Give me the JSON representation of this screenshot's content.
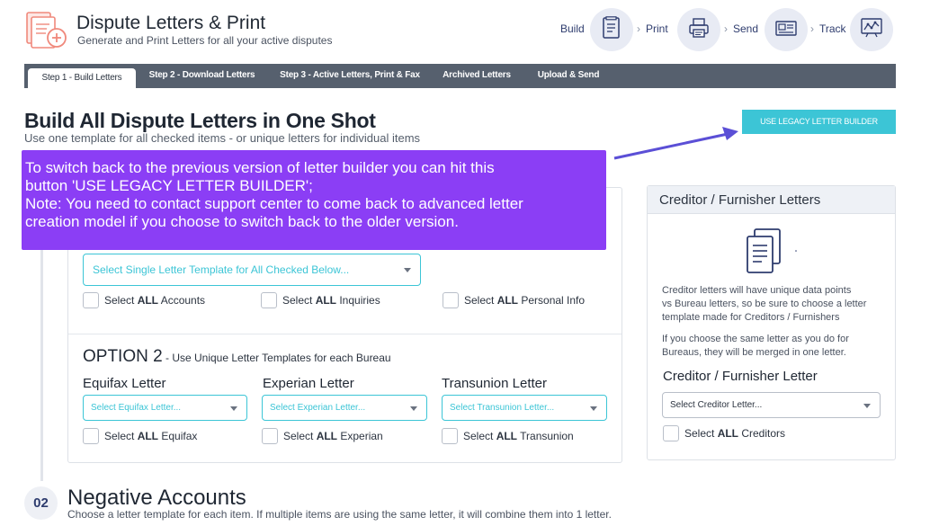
{
  "header": {
    "title": "Dispute Letters & Print",
    "subtitle": "Generate and Print Letters for all your active disputes"
  },
  "workflow": [
    {
      "label": "Build",
      "icon": "document-list-icon"
    },
    {
      "label": "Print",
      "icon": "printer-icon"
    },
    {
      "label": "Send",
      "icon": "mail-icon"
    },
    {
      "label": "Track",
      "icon": "chart-line-icon"
    }
  ],
  "tabs": [
    {
      "label": "Step 1 - Build Letters",
      "active": true
    },
    {
      "label": "Step 2 - Download Letters",
      "active": false
    },
    {
      "label": "Step 3 - Active Letters, Print & Fax",
      "active": false
    },
    {
      "label": "Archived Letters",
      "active": false
    },
    {
      "label": "Upload & Send",
      "active": false
    }
  ],
  "main": {
    "title": "Build All Dispute Letters in One Shot",
    "subtitle": "Use one template for all checked items - or unique letters for individual items",
    "legacy_button": "USE LEGACY LETTER BUILDER"
  },
  "callout": {
    "line1": "To switch back to the previous version of letter builder you can hit this",
    "line2": "button 'USE LEGACY LETTER BUILDER';",
    "line3": "Note: You need to contact support center to come back to advanced letter",
    "line4": "creation model if you choose to switch back to the older version."
  },
  "option1": {
    "select_placeholder": "Select Single Letter Template for All Checked Below...",
    "checkboxes": [
      {
        "prefix": "Select ",
        "bold": "ALL",
        "suffix": " Accounts"
      },
      {
        "prefix": "Select ",
        "bold": "ALL",
        "suffix": " Inquiries"
      },
      {
        "prefix": "Select ",
        "bold": "ALL",
        "suffix": " Personal Info"
      }
    ]
  },
  "option2": {
    "title": "OPTION 2",
    "subtitle": "- Use Unique Letter Templates for each Bureau",
    "bureaus": [
      {
        "heading": "Equifax Letter",
        "placeholder": "Select Equifax Letter...",
        "cb_prefix": "Select ",
        "cb_bold": "ALL",
        "cb_suffix": " Equifax"
      },
      {
        "heading": "Experian Letter",
        "placeholder": "Select Experian Letter...",
        "cb_prefix": "Select ",
        "cb_bold": "ALL",
        "cb_suffix": " Experian"
      },
      {
        "heading": "Transunion Letter",
        "placeholder": "Select Transunion Letter...",
        "cb_prefix": "Select ",
        "cb_bold": "ALL",
        "cb_suffix": " Transunion"
      }
    ]
  },
  "creditor": {
    "title": "Creditor / Furnisher Letters",
    "desc1": [
      "Creditor letters will have unique data points",
      "vs Bureau letters, so be sure to choose a letter",
      "template made for Creditors / Furnishers"
    ],
    "desc2": [
      "If you choose the same letter as you do for",
      "Bureaus, they will be merged in one letter."
    ],
    "heading": "Creditor / Furnisher Letter",
    "placeholder": "Select Creditor Letter...",
    "cb_prefix": "Select ",
    "cb_bold": "ALL",
    "cb_suffix": " Creditors"
  },
  "section2": {
    "number": "02",
    "title": "Negative Accounts",
    "subtitle": "Choose a letter template for each item.  If multiple items are using the same letter, it will combine them into 1 letter."
  },
  "colors": {
    "accent_cyan": "#3cc5d6",
    "callout_purple": "#8b3ef5",
    "tabbar": "#56606e",
    "arrow": "#5b4fd6"
  }
}
